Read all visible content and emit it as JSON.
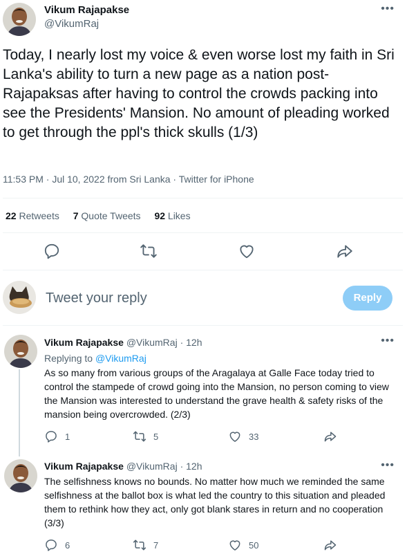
{
  "tweet": {
    "author_name": "Vikum Rajapakse",
    "author_handle": "@VikumRaj",
    "text": "Today, I nearly lost my voice & even worse lost my faith in Sri Lanka's ability to turn a new page as a nation post-Rajapaksas after having to control the crowds packing into see the Presidents' Mansion. No amount of pleading worked to get through the ppl's thick skulls (1/3)",
    "meta": "11:53 PM · Jul 10, 2022 from Sri Lanka · Twitter for iPhone",
    "stats": {
      "retweets_count": "22",
      "retweets_label": "Retweets",
      "quotes_count": "7",
      "quotes_label": "Quote Tweets",
      "likes_count": "92",
      "likes_label": "Likes"
    }
  },
  "composer": {
    "placeholder": "Tweet your reply",
    "button_label": "Reply",
    "button_color": "#8ecdf7"
  },
  "replies": [
    {
      "author_name": "Vikum Rajapakse",
      "author_handle": "@VikumRaj",
      "time": "12h",
      "replying_label": "Replying to",
      "replying_to": "@VikumRaj",
      "text": "As so many from various groups of the Aragalaya at Galle Face today tried to control the stampede of crowd going into the Mansion, no person coming to view the Mansion was interested to understand the grave health & safety risks of the mansion being overcrowded. (2/3)",
      "reply_count": "1",
      "retweet_count": "5",
      "like_count": "33"
    },
    {
      "author_name": "Vikum Rajapakse",
      "author_handle": "@VikumRaj",
      "time": "12h",
      "text": "The selfishness knows no bounds. No matter how much we reminded the same selfishness at the ballot box is what led the country to this situation and pleaded them to rethink how they act, only got blank stares in return and no cooperation (3/3)",
      "reply_count": "6",
      "retweet_count": "7",
      "like_count": "50"
    }
  ],
  "icons": {
    "more": "more-icon",
    "reply": "reply-icon",
    "retweet": "retweet-icon",
    "like": "like-icon",
    "share": "share-icon"
  },
  "colors": {
    "accent": "#1d9bf0",
    "muted": "#536471",
    "divider": "#eff3f4"
  },
  "separator": " · "
}
